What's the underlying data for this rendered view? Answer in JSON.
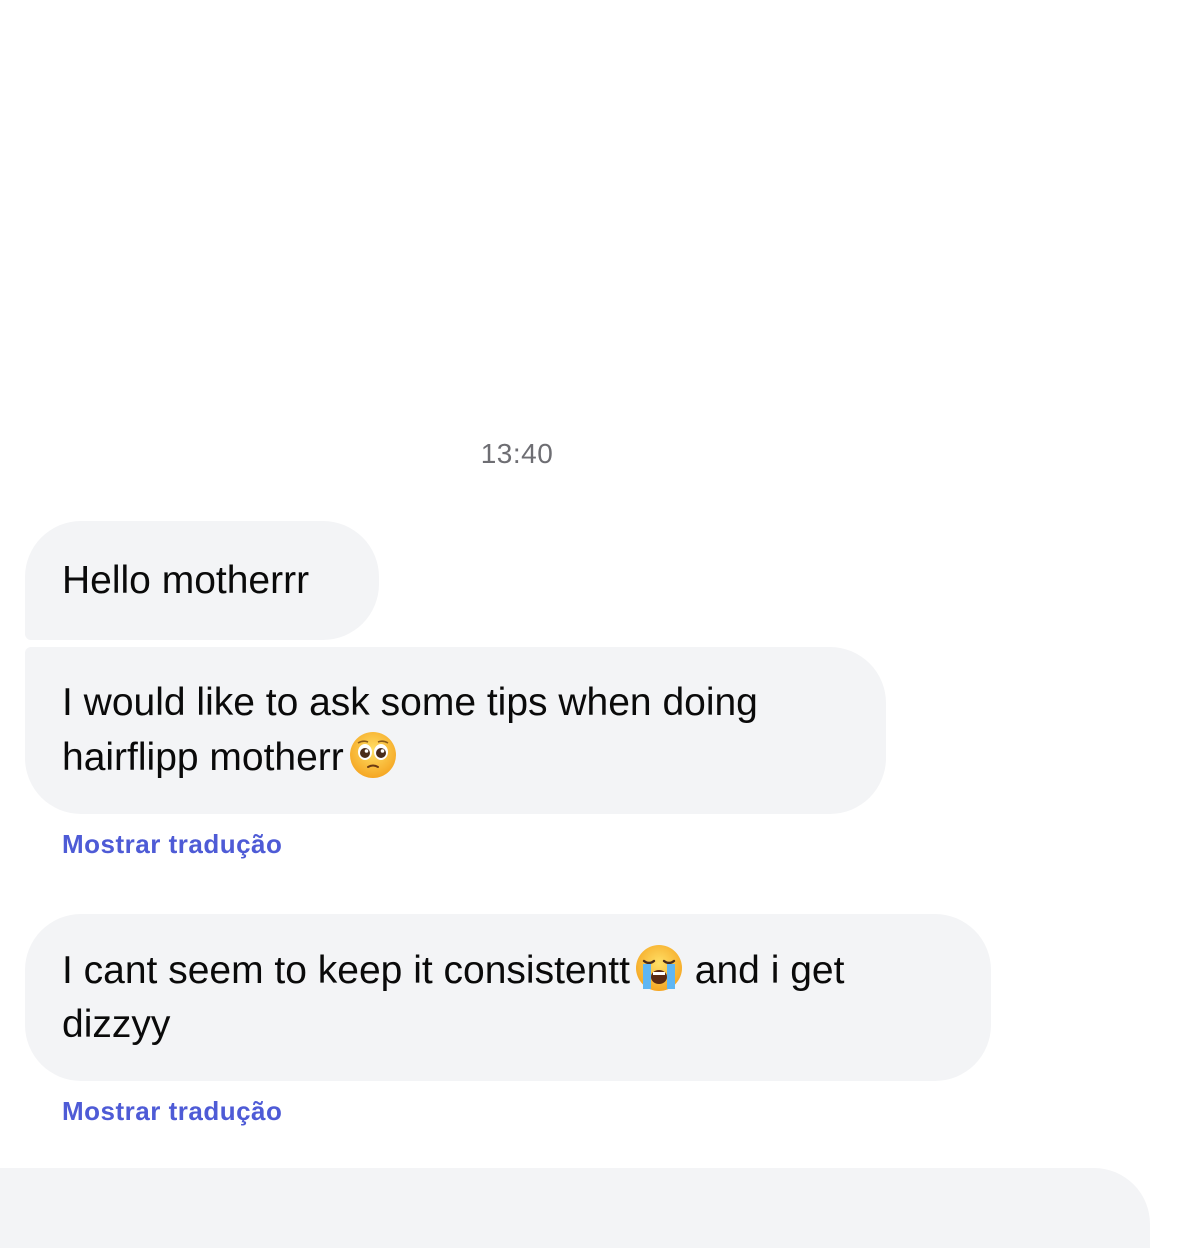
{
  "conversation": {
    "timestamp": "13:40",
    "messages": [
      {
        "text": "Hello motherrr",
        "emoji": null
      },
      {
        "text_before_emoji": "I would like to ask some tips when doing hairflipp motherr",
        "emoji": "pleading-face-icon",
        "text_after_emoji": ""
      },
      {
        "text_before_emoji": "I cant seem to keep it consistentt",
        "emoji": "loudly-crying-face-icon",
        "text_after_emoji": " and i get dizzyy"
      }
    ],
    "translate_label": "Mostrar tradução"
  },
  "colors": {
    "bubble_bg": "#f3f4f6",
    "link": "#4e5bd6",
    "timestamp": "#6e6e73",
    "text": "#0a0a0a"
  }
}
